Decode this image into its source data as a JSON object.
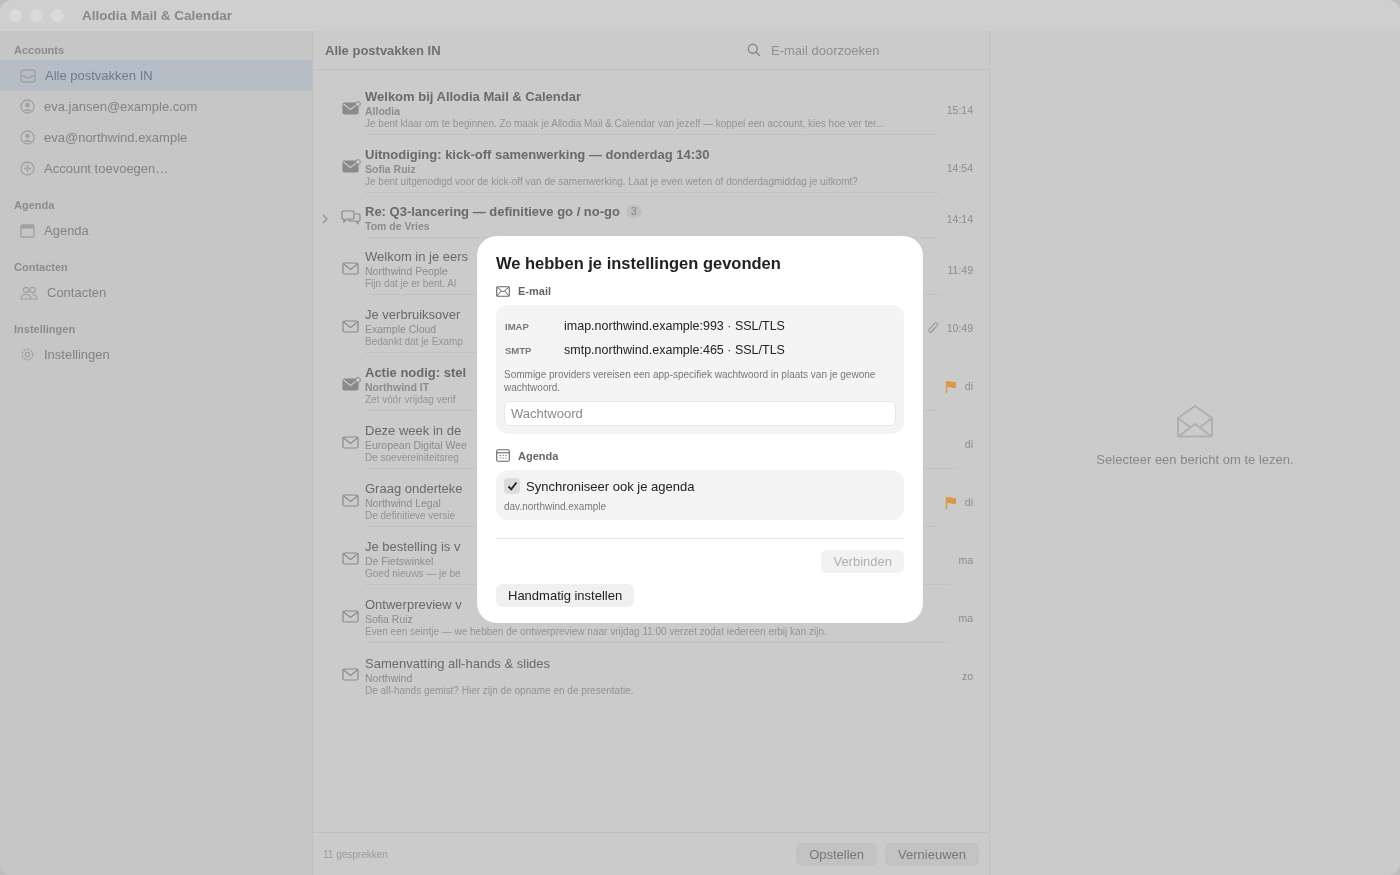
{
  "window": {
    "title": "Allodia Mail & Calendar"
  },
  "sidebar": {
    "sections": [
      {
        "title": "Accounts",
        "items": [
          {
            "label": "Alle postvakken IN",
            "kind": "inbox",
            "selected": true
          },
          {
            "label": "eva.jansen@example.com",
            "kind": "account",
            "selected": false
          },
          {
            "label": "eva@northwind.example",
            "kind": "account",
            "selected": false
          },
          {
            "label": "Account toevoegen…",
            "kind": "add",
            "selected": false
          }
        ]
      },
      {
        "title": "Agenda",
        "items": [
          {
            "label": "Agenda",
            "kind": "calendar",
            "selected": false
          }
        ]
      },
      {
        "title": "Contacten",
        "items": [
          {
            "label": "Contacten",
            "kind": "contacts",
            "selected": false
          }
        ]
      },
      {
        "title": "Instellingen",
        "items": [
          {
            "label": "Instellingen",
            "kind": "settings",
            "selected": false
          }
        ]
      }
    ]
  },
  "message_list": {
    "title": "Alle postvakken IN",
    "search": {
      "placeholder": "E-mail doorzoeken"
    },
    "rows": [
      {
        "kind": "message",
        "unread": true,
        "subject": "Welkom bij Allodia Mail & Calendar",
        "sender": "Allodia",
        "preview": "Je bent klaar om te beginnen. Zo maak je Allodia Mail & Calendar van jezelf — koppel een account, kies hoe ver ter...",
        "time": "15:14",
        "flagged": false,
        "attachment": false
      },
      {
        "kind": "message",
        "unread": true,
        "subject": "Uitnodiging: kick-off samenwerking — donderdag 14:30",
        "sender": "Sofia Ruiz",
        "preview": "Je bent uitgenodigd voor de kick-off van de samenwerking. Laat je even weten of donderdagmiddag je uitkomt?",
        "time": "14:54",
        "flagged": false,
        "attachment": false
      },
      {
        "kind": "thread",
        "unread": true,
        "subject": "Re: Q3-lancering — definitieve go / no-go",
        "count": "3",
        "sender": "Tom de Vries",
        "time": "14:14",
        "flagged": false,
        "attachment": false
      },
      {
        "kind": "message",
        "unread": false,
        "subject": "Welkom in je eers",
        "sender": "Northwind People",
        "preview": "Fijn dat je er bent. Al",
        "time": "11:49",
        "flagged": false,
        "attachment": false
      },
      {
        "kind": "message",
        "unread": false,
        "subject": "Je verbruiksover",
        "sender": "Example Cloud",
        "preview": "Bedankt dat je Examp",
        "time": "10:49",
        "flagged": false,
        "attachment": true
      },
      {
        "kind": "message",
        "unread": true,
        "subject": "Actie nodig: stel",
        "sender": "Northwind IT",
        "preview": "Zet vóór vrijdag verif",
        "time": "di",
        "flagged": true,
        "attachment": false
      },
      {
        "kind": "message",
        "unread": false,
        "subject": "Deze week in de",
        "sender": "European Digital Wee",
        "preview": "De soevereiniteitsreg",
        "time": "di",
        "flagged": false,
        "attachment": false
      },
      {
        "kind": "message",
        "unread": false,
        "subject": "Graag onderteke",
        "sender": "Northwind Legal",
        "preview": "De definitieve versie",
        "time": "di",
        "flagged": true,
        "attachment": false
      },
      {
        "kind": "message",
        "unread": false,
        "subject": "Je bestelling is v",
        "sender": "De Fietswinkel",
        "preview": "Goed nieuws — je be",
        "time": "ma",
        "flagged": false,
        "attachment": false
      },
      {
        "kind": "message",
        "unread": false,
        "subject": "Ontwerpreview v",
        "sender": "Sofia Ruiz",
        "preview": "Even een seintje — we hebben de ontwerpreview naar vrijdag 11:00 verzet zodat iedereen erbij kan zijn.",
        "time": "ma",
        "flagged": false,
        "attachment": false
      },
      {
        "kind": "message",
        "unread": false,
        "subject": "Samenvatting all-hands & slides",
        "sender": "Northwind",
        "preview": "De all-hands gemist? Hier zijn de opname en de presentatie.",
        "time": "zo",
        "flagged": false,
        "attachment": false
      }
    ],
    "footer": {
      "count": "11 gesprekken",
      "buttons": [
        "Opstellen",
        "Vernieuwen"
      ]
    }
  },
  "reader": {
    "empty_text": "Selecteer een bericht om te lezen."
  },
  "dialog": {
    "title": "We hebben je instellingen gevonden",
    "email": {
      "heading": "E-mail",
      "servers": [
        {
          "label": "IMAP",
          "value": "imap.northwind.example:993 · SSL/TLS"
        },
        {
          "label": "SMTP",
          "value": "smtp.northwind.example:465 · SSL/TLS"
        }
      ],
      "note": "Sommige providers vereisen een app-specifiek wachtwoord in plaats van je gewone wachtwoord.",
      "password": {
        "placeholder": "Wachtwoord"
      }
    },
    "calendar": {
      "heading": "Agenda",
      "sync": {
        "label": "Synchroniseer ook je agenda",
        "checked": true
      },
      "host": "dav.northwind.example"
    },
    "connect": {
      "label": "Verbinden",
      "disabled": true
    },
    "manual": {
      "label": "Handmatig instellen"
    }
  }
}
